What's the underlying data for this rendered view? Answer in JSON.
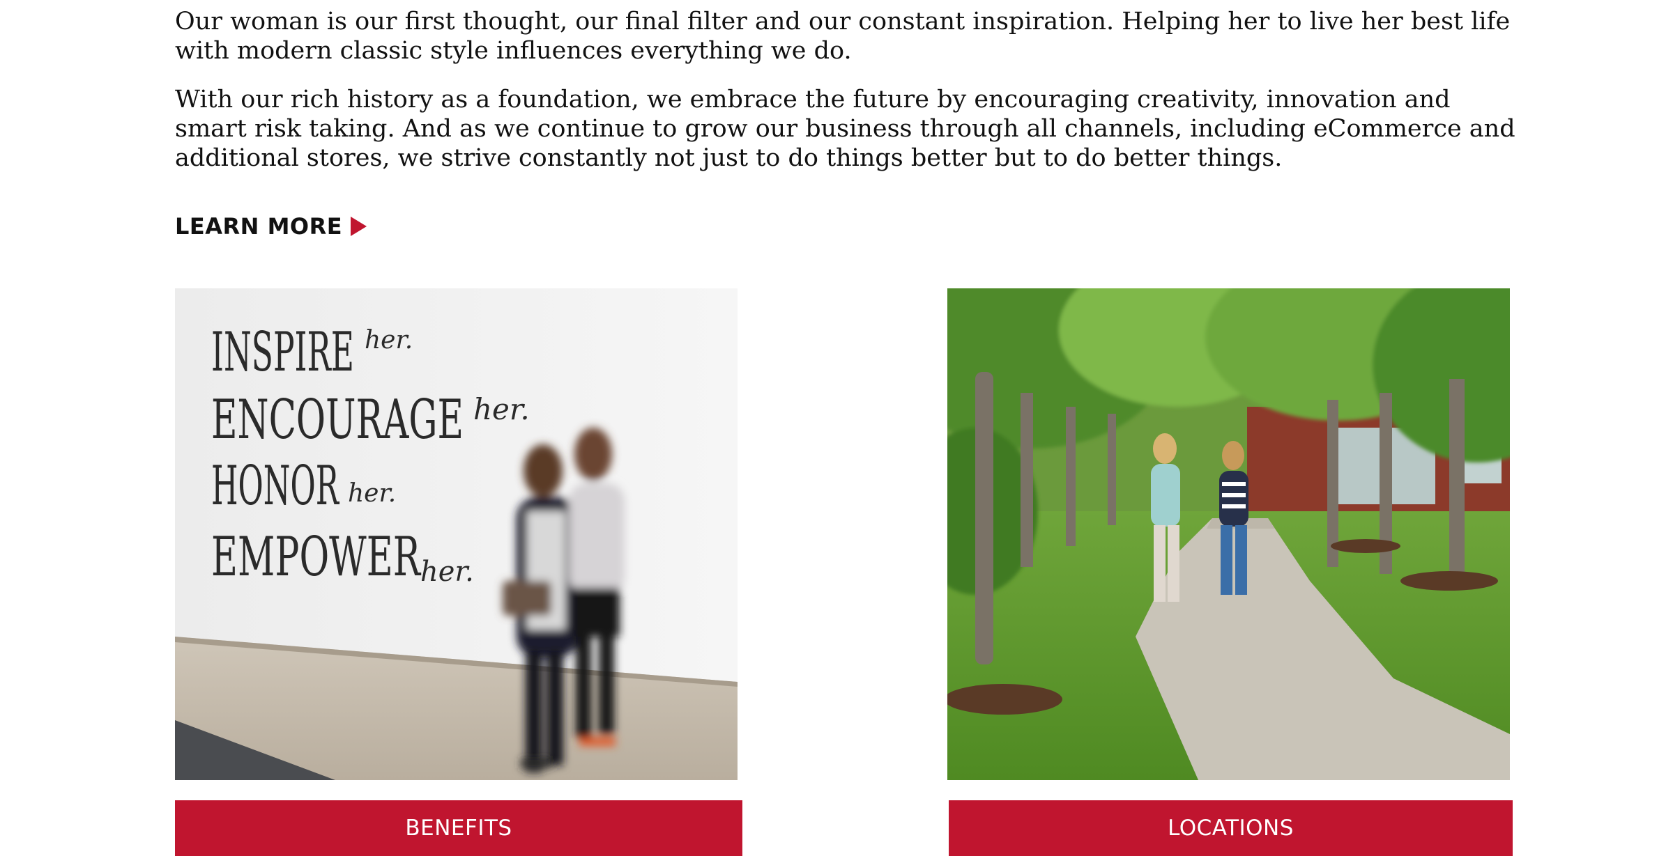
{
  "intro": {
    "paragraph_1": "Our woman is our first thought, our final filter and our constant inspiration. Helping her to live her best life with modern classic style influences everything we do.",
    "paragraph_2": "With our rich history as a foundation, we embrace the future by encouraging creativity, innovation and smart risk taking. And as we continue to grow our business through all channels, including eCommerce and additional stores, we strive constantly not just to do things better but to do better things."
  },
  "learn_more": {
    "label": "LEARN MORE",
    "icon": "triangle-right-icon"
  },
  "left_photo": {
    "wall_lines": [
      {
        "word": "INSPIRE",
        "her": "her."
      },
      {
        "word": "ENCOURAGE",
        "her": "her."
      },
      {
        "word": "HONOR",
        "her": "her."
      },
      {
        "word": "EMPOWER",
        "her": "her."
      }
    ]
  },
  "buttons": {
    "benefits": "BENEFITS",
    "locations": "LOCATIONS"
  },
  "colors": {
    "accent": "#c0152f",
    "text": "#111111",
    "background": "#ffffff"
  }
}
